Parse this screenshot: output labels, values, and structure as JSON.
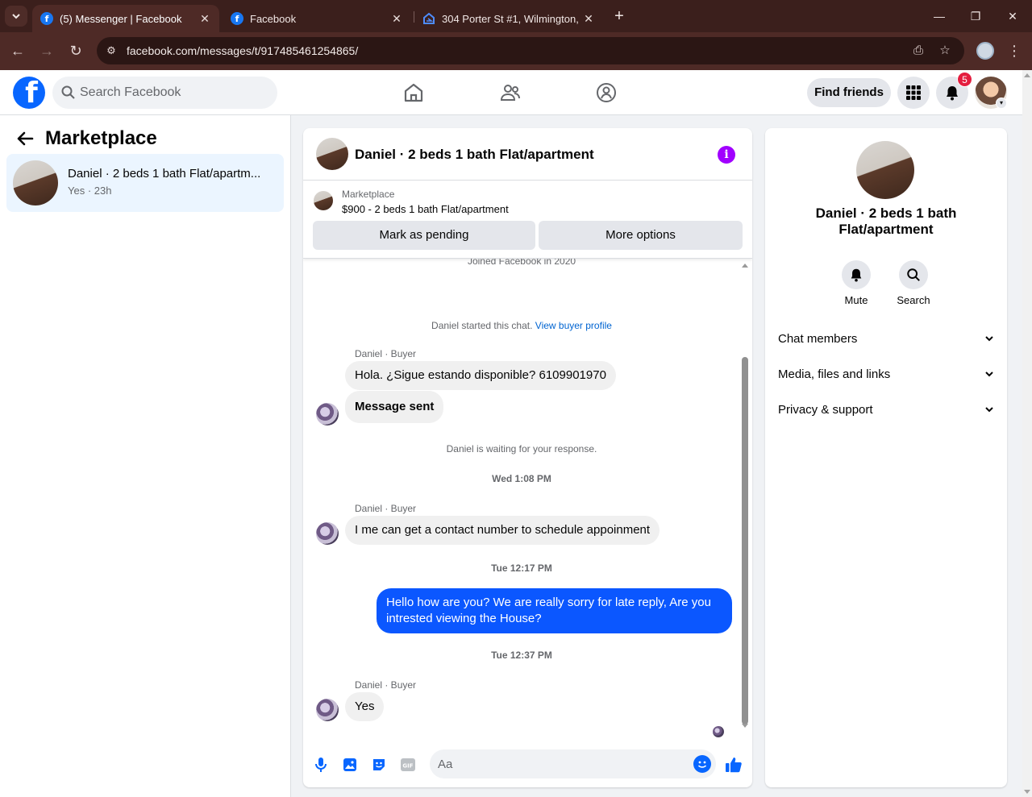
{
  "browser": {
    "tabs": [
      {
        "title": "(5) Messenger | Facebook",
        "close": "✕"
      },
      {
        "title": "Facebook",
        "close": "✕"
      },
      {
        "title": "304 Porter St #1, Wilmington, D",
        "close": "✕"
      }
    ],
    "new_tab": "+",
    "url": "facebook.com/messages/t/917485461254865/"
  },
  "fb_header": {
    "search_placeholder": "Search Facebook",
    "find_friends_label": "Find friends",
    "notification_count": "5"
  },
  "left_panel": {
    "title": "Marketplace",
    "conversations": [
      {
        "name": "Daniel · 2 beds 1 bath Flat/apartm...",
        "subtitle": "Yes · 23h"
      }
    ]
  },
  "chat": {
    "title": "Daniel · 2 beds 1 bath Flat/apartment",
    "marketplace_label": "Marketplace",
    "listing": "$900 - 2 beds 1 bath Flat/apartment",
    "mark_pending_label": "Mark as pending",
    "more_options_label": "More options",
    "joined_note": "Joined Facebook in 2020",
    "started_note": "Daniel started this chat.",
    "view_profile_link": "View buyer profile",
    "sender_label": "Daniel · Buyer",
    "msg1": "Hola. ¿Sigue estando disponible? 6109901970",
    "msg2": "Message sent",
    "waiting_note": "Daniel is waiting for your response.",
    "time1": "Wed 1:08 PM",
    "msg3": "I me can get a contact number to schedule appoinment",
    "time2": "Tue 12:17 PM",
    "my_msg": "Hello how are you? We are really sorry for late reply, Are you intrested viewing the House?",
    "time3": "Tue 12:37 PM",
    "msg4": "Yes",
    "composer_placeholder": "Aa"
  },
  "info_panel": {
    "title": "Daniel · 2 beds 1 bath Flat/apartment",
    "mute_label": "Mute",
    "search_label": "Search",
    "sections": [
      "Chat members",
      "Media, files and links",
      "Privacy & support"
    ]
  },
  "colors": {
    "accent": "#0866ff",
    "my_bubble": "#0b57ff",
    "info_purple": "#a100ff",
    "badge_red": "#e41e3f"
  }
}
